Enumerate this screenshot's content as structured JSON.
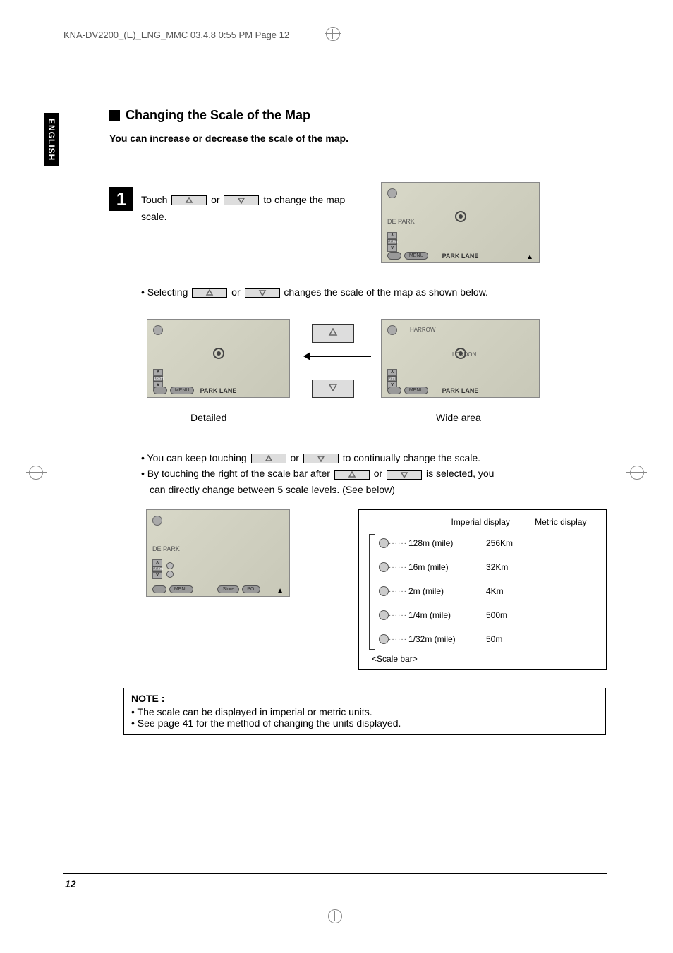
{
  "header": "KNA-DV2200_(E)_ENG_MMC  03.4.8  0:55 PM  Page 12",
  "language_tab": "ENGLISH",
  "section_title": "Changing the Scale of the Map",
  "section_subtitle": "You can increase or decrease the scale of the map.",
  "step": {
    "number": "1",
    "text_before": "Touch ",
    "or": "or",
    "text_after": " to change the map scale."
  },
  "selecting": {
    "prefix": "• Selecting ",
    "or": "or",
    "suffix": "changes the scale of the map as shown below."
  },
  "labels": {
    "detailed": "Detailed",
    "wide_area": "Wide area"
  },
  "maps": {
    "de_park": "DE PARK",
    "park_lane": "PARK LANE",
    "menu": "MENU",
    "store": "Store",
    "poi": "POI",
    "harrow": "HARROW",
    "london": "LONDON",
    "scale_1_16": "1/16m",
    "scale_1_32": "1/32m",
    "scale_2m": "2 m"
  },
  "keep": {
    "line1_a": "• You can keep touching ",
    "line1_or": "or",
    "line1_b": " to continually change the scale.",
    "line2_a": "• By touching the right of the scale bar after ",
    "line2_or": "or",
    "line2_b": " is selected, you",
    "line3": "can directly change between 5 scale levels. (See below)"
  },
  "scale_table": {
    "imperial_header": "Imperial display",
    "metric_header": "Metric display",
    "rows": [
      {
        "imperial": "128m (mile)",
        "metric": "256Km"
      },
      {
        "imperial": "16m (mile)",
        "metric": "32Km"
      },
      {
        "imperial": "2m (mile)",
        "metric": "4Km"
      },
      {
        "imperial": "1/4m (mile)",
        "metric": "500m"
      },
      {
        "imperial": "1/32m (mile)",
        "metric": "50m"
      }
    ],
    "scale_bar": "<Scale bar>"
  },
  "note": {
    "title": "NOTE :",
    "line1": "• The scale can be displayed in imperial or metric units.",
    "line2": "• See page 41 for the method of changing the units displayed."
  },
  "page_number": "12"
}
